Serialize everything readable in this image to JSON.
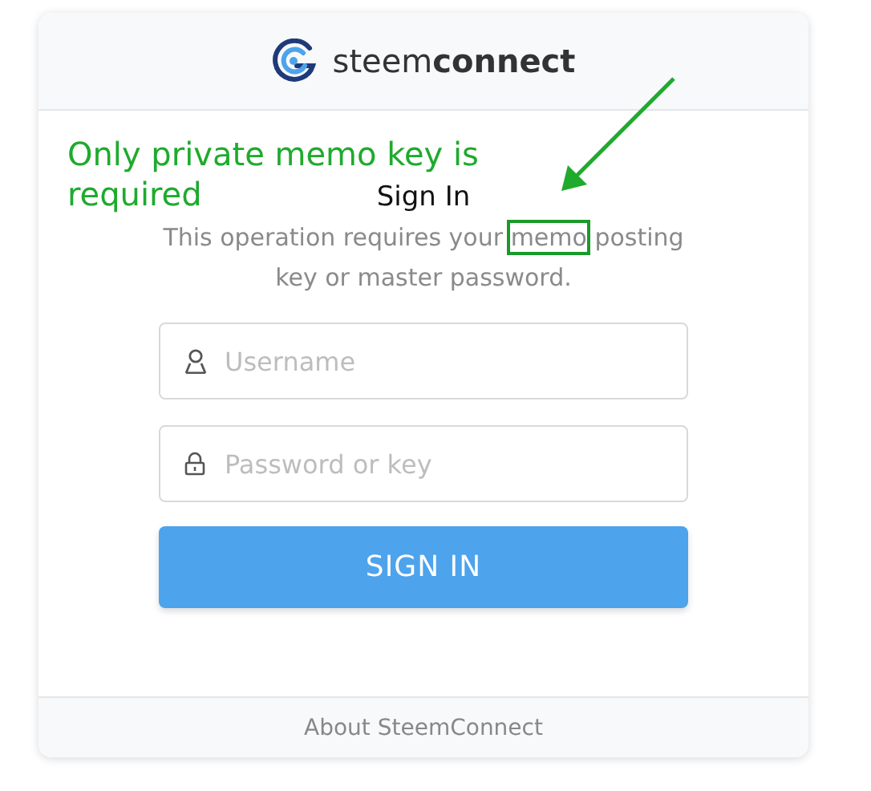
{
  "header": {
    "brand": "steem**connect**"
  },
  "annotation": {
    "lines": [
      "Only private memo key is",
      "required"
    ]
  },
  "title": "Sign In",
  "description": {
    "before": "This operation requires your",
    "highlighted": "memo",
    "after": "posting key or master password."
  },
  "fields": [
    {
      "kind": "user",
      "placeholder": "Username"
    },
    {
      "kind": "lock",
      "placeholder": "Password or key"
    }
  ],
  "button": "SIGN IN",
  "footer": {
    "link": "About SteemConnect"
  }
}
